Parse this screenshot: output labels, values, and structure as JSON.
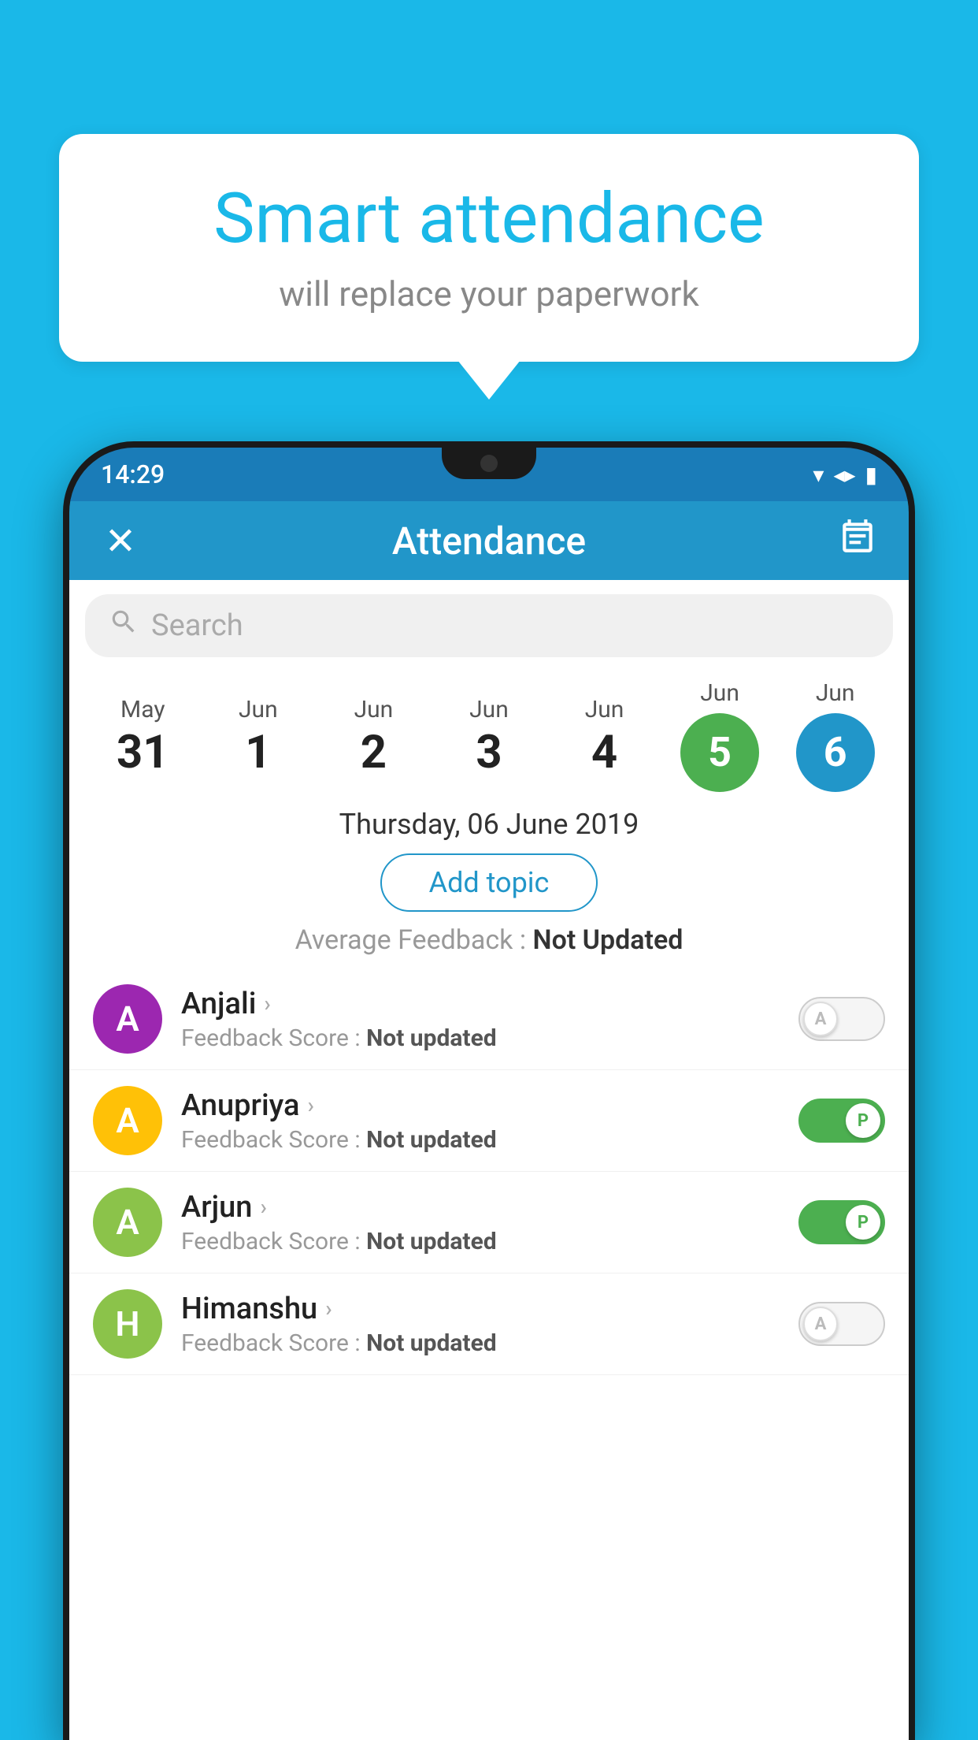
{
  "background_color": "#1ab8e8",
  "speech_bubble": {
    "title": "Smart attendance",
    "subtitle": "will replace your paperwork"
  },
  "status_bar": {
    "time": "14:29",
    "wifi_icon": "▼",
    "signal_icon": "▲",
    "battery_icon": "▮"
  },
  "app_bar": {
    "close_label": "✕",
    "title": "Attendance",
    "calendar_icon": "📅"
  },
  "search": {
    "placeholder": "Search"
  },
  "calendar": {
    "dates": [
      {
        "month": "May",
        "day": "31",
        "state": "normal"
      },
      {
        "month": "Jun",
        "day": "1",
        "state": "normal"
      },
      {
        "month": "Jun",
        "day": "2",
        "state": "normal"
      },
      {
        "month": "Jun",
        "day": "3",
        "state": "normal"
      },
      {
        "month": "Jun",
        "day": "4",
        "state": "normal"
      },
      {
        "month": "Jun",
        "day": "5",
        "state": "today"
      },
      {
        "month": "Jun",
        "day": "6",
        "state": "selected"
      }
    ],
    "selected_date_text": "Thursday, 06 June 2019"
  },
  "add_topic_label": "Add topic",
  "avg_feedback_label": "Average Feedback :",
  "avg_feedback_value": "Not Updated",
  "students": [
    {
      "name": "Anjali",
      "avatar_letter": "A",
      "avatar_color": "#9c27b0",
      "feedback_label": "Feedback Score :",
      "feedback_value": "Not updated",
      "toggle_state": "off",
      "toggle_letter": "A"
    },
    {
      "name": "Anupriya",
      "avatar_letter": "A",
      "avatar_color": "#ffc107",
      "feedback_label": "Feedback Score :",
      "feedback_value": "Not updated",
      "toggle_state": "on",
      "toggle_letter": "P"
    },
    {
      "name": "Arjun",
      "avatar_letter": "A",
      "avatar_color": "#8bc34a",
      "feedback_label": "Feedback Score :",
      "feedback_value": "Not updated",
      "toggle_state": "on",
      "toggle_letter": "P"
    },
    {
      "name": "Himanshu",
      "avatar_letter": "H",
      "avatar_color": "#8bc34a",
      "feedback_label": "Feedback Score :",
      "feedback_value": "Not updated",
      "toggle_state": "off",
      "toggle_letter": "A"
    }
  ]
}
